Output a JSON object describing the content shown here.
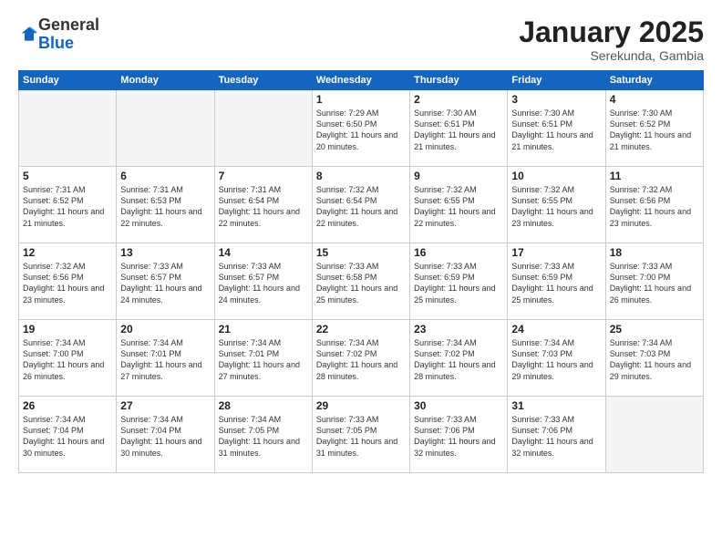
{
  "logo": {
    "general": "General",
    "blue": "Blue"
  },
  "title": "January 2025",
  "subtitle": "Serekunda, Gambia",
  "days": [
    "Sunday",
    "Monday",
    "Tuesday",
    "Wednesday",
    "Thursday",
    "Friday",
    "Saturday"
  ],
  "weeks": [
    [
      {
        "day": "",
        "info": ""
      },
      {
        "day": "",
        "info": ""
      },
      {
        "day": "",
        "info": ""
      },
      {
        "day": "1",
        "info": "Sunrise: 7:29 AM\nSunset: 6:50 PM\nDaylight: 11 hours\nand 20 minutes."
      },
      {
        "day": "2",
        "info": "Sunrise: 7:30 AM\nSunset: 6:51 PM\nDaylight: 11 hours\nand 21 minutes."
      },
      {
        "day": "3",
        "info": "Sunrise: 7:30 AM\nSunset: 6:51 PM\nDaylight: 11 hours\nand 21 minutes."
      },
      {
        "day": "4",
        "info": "Sunrise: 7:30 AM\nSunset: 6:52 PM\nDaylight: 11 hours\nand 21 minutes."
      }
    ],
    [
      {
        "day": "5",
        "info": "Sunrise: 7:31 AM\nSunset: 6:52 PM\nDaylight: 11 hours\nand 21 minutes."
      },
      {
        "day": "6",
        "info": "Sunrise: 7:31 AM\nSunset: 6:53 PM\nDaylight: 11 hours\nand 22 minutes."
      },
      {
        "day": "7",
        "info": "Sunrise: 7:31 AM\nSunset: 6:54 PM\nDaylight: 11 hours\nand 22 minutes."
      },
      {
        "day": "8",
        "info": "Sunrise: 7:32 AM\nSunset: 6:54 PM\nDaylight: 11 hours\nand 22 minutes."
      },
      {
        "day": "9",
        "info": "Sunrise: 7:32 AM\nSunset: 6:55 PM\nDaylight: 11 hours\nand 22 minutes."
      },
      {
        "day": "10",
        "info": "Sunrise: 7:32 AM\nSunset: 6:55 PM\nDaylight: 11 hours\nand 23 minutes."
      },
      {
        "day": "11",
        "info": "Sunrise: 7:32 AM\nSunset: 6:56 PM\nDaylight: 11 hours\nand 23 minutes."
      }
    ],
    [
      {
        "day": "12",
        "info": "Sunrise: 7:32 AM\nSunset: 6:56 PM\nDaylight: 11 hours\nand 23 minutes."
      },
      {
        "day": "13",
        "info": "Sunrise: 7:33 AM\nSunset: 6:57 PM\nDaylight: 11 hours\nand 24 minutes."
      },
      {
        "day": "14",
        "info": "Sunrise: 7:33 AM\nSunset: 6:57 PM\nDaylight: 11 hours\nand 24 minutes."
      },
      {
        "day": "15",
        "info": "Sunrise: 7:33 AM\nSunset: 6:58 PM\nDaylight: 11 hours\nand 25 minutes."
      },
      {
        "day": "16",
        "info": "Sunrise: 7:33 AM\nSunset: 6:59 PM\nDaylight: 11 hours\nand 25 minutes."
      },
      {
        "day": "17",
        "info": "Sunrise: 7:33 AM\nSunset: 6:59 PM\nDaylight: 11 hours\nand 25 minutes."
      },
      {
        "day": "18",
        "info": "Sunrise: 7:33 AM\nSunset: 7:00 PM\nDaylight: 11 hours\nand 26 minutes."
      }
    ],
    [
      {
        "day": "19",
        "info": "Sunrise: 7:34 AM\nSunset: 7:00 PM\nDaylight: 11 hours\nand 26 minutes."
      },
      {
        "day": "20",
        "info": "Sunrise: 7:34 AM\nSunset: 7:01 PM\nDaylight: 11 hours\nand 27 minutes."
      },
      {
        "day": "21",
        "info": "Sunrise: 7:34 AM\nSunset: 7:01 PM\nDaylight: 11 hours\nand 27 minutes."
      },
      {
        "day": "22",
        "info": "Sunrise: 7:34 AM\nSunset: 7:02 PM\nDaylight: 11 hours\nand 28 minutes."
      },
      {
        "day": "23",
        "info": "Sunrise: 7:34 AM\nSunset: 7:02 PM\nDaylight: 11 hours\nand 28 minutes."
      },
      {
        "day": "24",
        "info": "Sunrise: 7:34 AM\nSunset: 7:03 PM\nDaylight: 11 hours\nand 29 minutes."
      },
      {
        "day": "25",
        "info": "Sunrise: 7:34 AM\nSunset: 7:03 PM\nDaylight: 11 hours\nand 29 minutes."
      }
    ],
    [
      {
        "day": "26",
        "info": "Sunrise: 7:34 AM\nSunset: 7:04 PM\nDaylight: 11 hours\nand 30 minutes."
      },
      {
        "day": "27",
        "info": "Sunrise: 7:34 AM\nSunset: 7:04 PM\nDaylight: 11 hours\nand 30 minutes."
      },
      {
        "day": "28",
        "info": "Sunrise: 7:34 AM\nSunset: 7:05 PM\nDaylight: 11 hours\nand 31 minutes."
      },
      {
        "day": "29",
        "info": "Sunrise: 7:33 AM\nSunset: 7:05 PM\nDaylight: 11 hours\nand 31 minutes."
      },
      {
        "day": "30",
        "info": "Sunrise: 7:33 AM\nSunset: 7:06 PM\nDaylight: 11 hours\nand 32 minutes."
      },
      {
        "day": "31",
        "info": "Sunrise: 7:33 AM\nSunset: 7:06 PM\nDaylight: 11 hours\nand 32 minutes."
      },
      {
        "day": "",
        "info": ""
      }
    ]
  ]
}
